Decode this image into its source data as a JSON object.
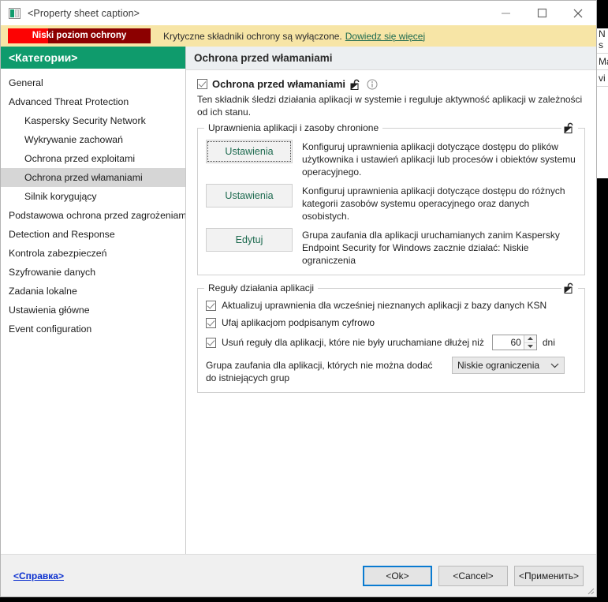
{
  "window": {
    "title": "<Property sheet caption>",
    "icon": "app-icon",
    "controls": {
      "minimize": "minimize-icon",
      "maximize": "maximize-icon",
      "close": "close-icon"
    }
  },
  "banner": {
    "status_badge": "Niski poziom ochrony",
    "message": "Krytyczne składniki ochrony są wyłączone.",
    "link": "Dowiedz się więcej",
    "badge_color": "#8c0000",
    "badge_fill_color": "#fc0303",
    "background_color": "#f7e5a6",
    "link_color": "#1d6a4f"
  },
  "sidebar": {
    "header": "<Категории>",
    "header_color": "#0f9b6c",
    "items": [
      {
        "label": "General",
        "indent": false,
        "selected": false
      },
      {
        "label": "Advanced Threat Protection",
        "indent": false,
        "selected": false
      },
      {
        "label": "Kaspersky Security Network",
        "indent": true,
        "selected": false
      },
      {
        "label": "Wykrywanie zachowań",
        "indent": true,
        "selected": false
      },
      {
        "label": "Ochrona przed exploitami",
        "indent": true,
        "selected": false
      },
      {
        "label": "Ochrona przed włamaniami",
        "indent": true,
        "selected": true
      },
      {
        "label": "Silnik korygujący",
        "indent": true,
        "selected": false
      },
      {
        "label": "Podstawowa ochrona przed zagrożeniami",
        "indent": false,
        "selected": false
      },
      {
        "label": "Detection and Response",
        "indent": false,
        "selected": false
      },
      {
        "label": "Kontrola zabezpieczeń",
        "indent": false,
        "selected": false
      },
      {
        "label": "Szyfrowanie danych",
        "indent": false,
        "selected": false
      },
      {
        "label": "Zadania lokalne",
        "indent": false,
        "selected": false
      },
      {
        "label": "Ustawienia główne",
        "indent": false,
        "selected": false
      },
      {
        "label": "Event configuration",
        "indent": false,
        "selected": false
      }
    ]
  },
  "pane": {
    "header": "Ochrona przed włamaniami",
    "component": {
      "enabled": true,
      "title": "Ochrona przed włamaniami",
      "lock_icon": "unlocked-padlock-icon",
      "info_icon": "info-icon",
      "description": "Ten składnik śledzi działania aplikacji w systemie i reguluje aktywność aplikacji w zależności od ich stanu."
    },
    "group_permissions": {
      "legend": "Uprawnienia aplikacji i zasoby chronione",
      "lock_icon": "unlocked-padlock-icon",
      "rows": [
        {
          "button": "Ustawienia",
          "focused": true,
          "description": "Konfiguruj uprawnienia aplikacji dotyczące dostępu do plików użytkownika i ustawień aplikacji lub procesów i obiektów systemu operacyjnego."
        },
        {
          "button": "Ustawienia",
          "focused": false,
          "description": "Konfiguruj uprawnienia aplikacji dotyczące dostępu do różnych kategorii zasobów systemu operacyjnego oraz danych osobistych."
        },
        {
          "button": "Edytuj",
          "focused": false,
          "description": "Grupa zaufania dla aplikacji uruchamianych zanim Kaspersky Endpoint Security for Windows zacznie działać: Niskie ograniczenia"
        }
      ]
    },
    "group_rules": {
      "legend": "Reguły działania aplikacji",
      "lock_icon": "unlocked-padlock-icon",
      "checkboxes": [
        {
          "label": "Aktualizuj uprawnienia dla wcześniej nieznanych aplikacji z bazy danych KSN",
          "checked": true
        },
        {
          "label": "Ufaj aplikacjom podpisanym cyfrowo",
          "checked": true
        },
        {
          "label": "Usuń reguły dla aplikacji, które nie były uruchamiane dłużej niż",
          "checked": true
        }
      ],
      "spinner": {
        "value": "60",
        "unit": "dni"
      },
      "combo": {
        "label": "Grupa zaufania dla aplikacji, których nie można dodać do istniejących grup",
        "value": "Niskie ograniczenia",
        "chevron": "chevron-down-icon"
      }
    }
  },
  "footer": {
    "help": "<Справка>",
    "ok": "<Ok>",
    "cancel": "<Cancel>",
    "apply": "<Применить>",
    "default_button_color": "#0a7bd1"
  },
  "background_window": {
    "fragments": [
      "N",
      "s",
      "Ma",
      "vi"
    ]
  }
}
